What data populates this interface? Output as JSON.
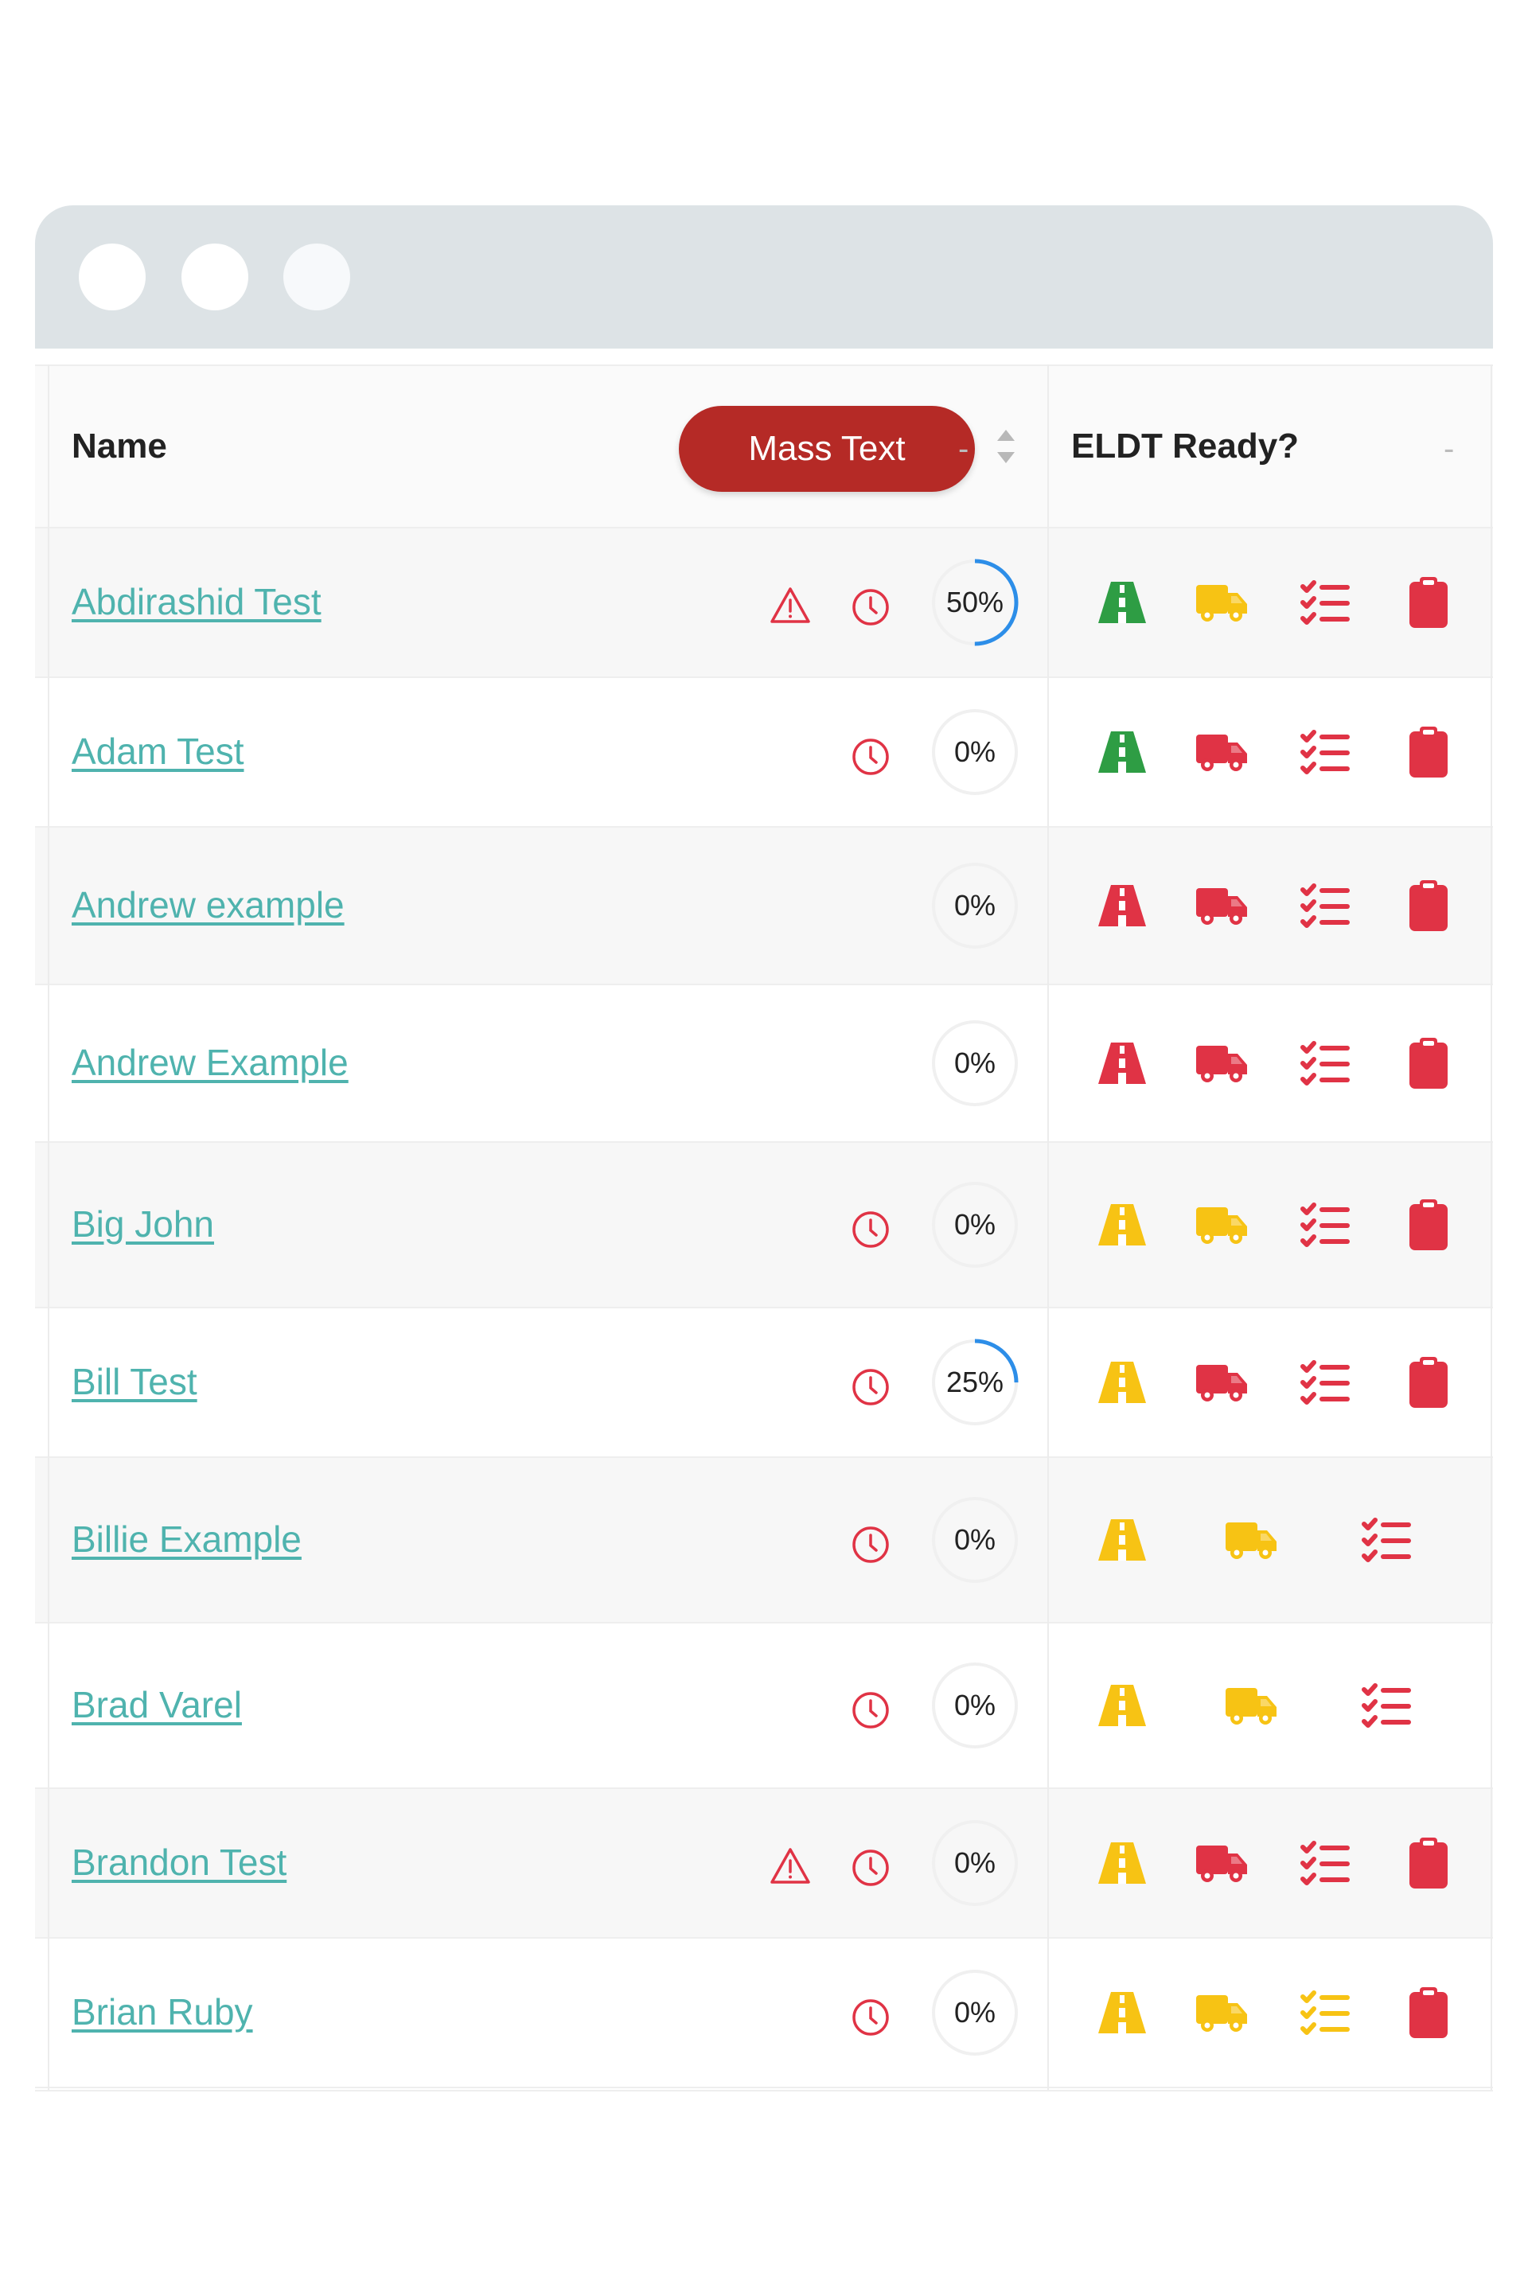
{
  "window": {
    "traffic_lights": [
      "close",
      "minimize",
      "maximize"
    ]
  },
  "table": {
    "headers": {
      "name": "Name",
      "mass_text": "Mass Text",
      "name_sort_dash": "-",
      "eldt": "ELDT Ready?",
      "eldt_dash": "-"
    },
    "colors": {
      "green": "#2e9d44",
      "yellow": "#f7c314",
      "red": "#e03345",
      "link": "#4fb3ae",
      "progress": "#2d8ee8",
      "button": "#b52a26"
    },
    "rows": [
      {
        "name": "Abdirashid Test",
        "warning": true,
        "clock": true,
        "progress_label": "50%",
        "progress": 50,
        "eldt": {
          "road": "green",
          "truck": "yellow",
          "checklist": "red",
          "clipboard": "red"
        }
      },
      {
        "name": "Adam Test",
        "warning": false,
        "clock": true,
        "progress_label": "0%",
        "progress": 0,
        "eldt": {
          "road": "green",
          "truck": "red",
          "checklist": "red",
          "clipboard": "red"
        }
      },
      {
        "name": "Andrew example",
        "warning": false,
        "clock": false,
        "progress_label": "0%",
        "progress": 0,
        "eldt": {
          "road": "red",
          "truck": "red",
          "checklist": "red",
          "clipboard": "red"
        }
      },
      {
        "name": "Andrew Example",
        "warning": false,
        "clock": false,
        "progress_label": "0%",
        "progress": 0,
        "eldt": {
          "road": "red",
          "truck": "red",
          "checklist": "red",
          "clipboard": "red"
        }
      },
      {
        "name": "Big John",
        "warning": false,
        "clock": true,
        "progress_label": "0%",
        "progress": 0,
        "eldt": {
          "road": "yellow",
          "truck": "yellow",
          "checklist": "red",
          "clipboard": "red"
        }
      },
      {
        "name": "Bill Test",
        "warning": false,
        "clock": true,
        "progress_label": "25%",
        "progress": 25,
        "eldt": {
          "road": "yellow",
          "truck": "red",
          "checklist": "red",
          "clipboard": "red"
        }
      },
      {
        "name": "Billie Example",
        "warning": false,
        "clock": true,
        "progress_label": "0%",
        "progress": 0,
        "eldt": {
          "road": "yellow",
          "truck": "yellow",
          "checklist": "red",
          "clipboard": null
        }
      },
      {
        "name": "Brad Varel",
        "warning": false,
        "clock": true,
        "progress_label": "0%",
        "progress": 0,
        "eldt": {
          "road": "yellow",
          "truck": "yellow",
          "checklist": "red",
          "clipboard": null
        }
      },
      {
        "name": "Brandon Test",
        "warning": true,
        "clock": true,
        "progress_label": "0%",
        "progress": 0,
        "eldt": {
          "road": "yellow",
          "truck": "red",
          "checklist": "red",
          "clipboard": "red"
        }
      },
      {
        "name": "Brian Ruby",
        "warning": false,
        "clock": true,
        "progress_label": "0%",
        "progress": 0,
        "eldt": {
          "road": "yellow",
          "truck": "yellow",
          "checklist": "yellow",
          "clipboard": "red"
        }
      }
    ]
  }
}
